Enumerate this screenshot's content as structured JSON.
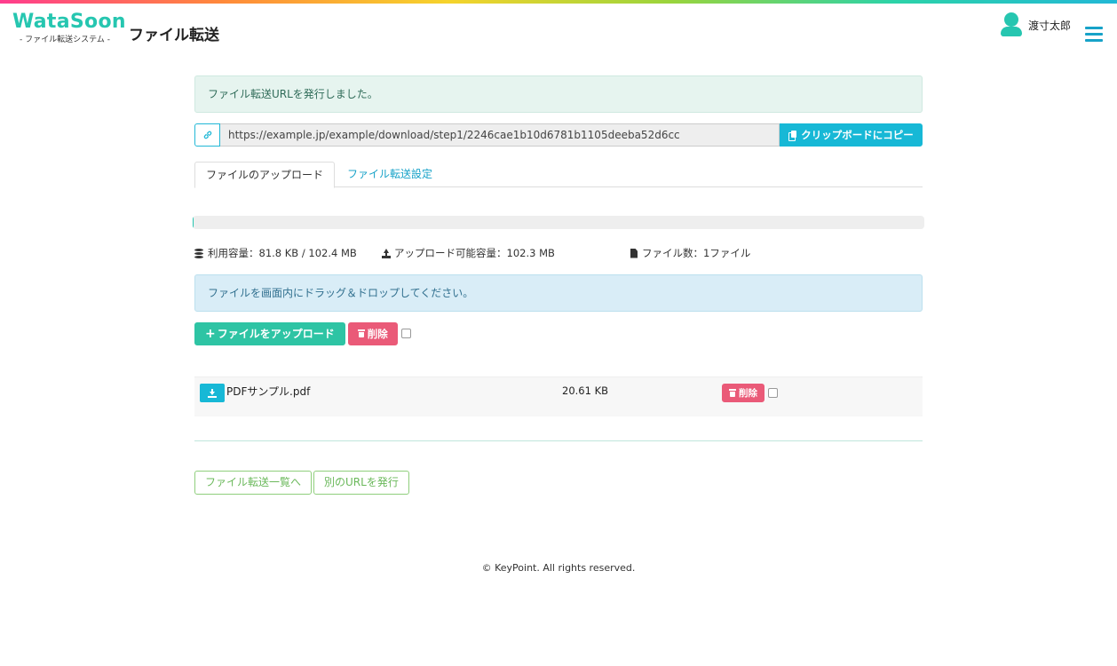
{
  "header": {
    "logo_main": "WataSoon",
    "logo_sub": "- ファイル転送システム -",
    "title": "ファイル転送",
    "user_name": "渡寸太郎"
  },
  "alert_success": "ファイル転送URLを発行しました。",
  "url": {
    "value": "https://example.jp/example/download/step1/2246cae1b10d6781b1105deeba52d6cc",
    "copy_label": "クリップボードにコピー"
  },
  "tabs": [
    {
      "label": "ファイルのアップロード",
      "active": true
    },
    {
      "label": "ファイル転送設定",
      "active": false
    }
  ],
  "progress": {
    "value_percent": 0.08
  },
  "stats": {
    "usage": "利用容量：81.8 KB / 102.4 MB",
    "uploadable": "アップロード可能容量：102.3 MB",
    "file_count": "ファイル数：1ファイル"
  },
  "alert_info": "ファイルを画面内にドラッグ＆ドロップしてください。",
  "actions": {
    "upload_label": "ファイルをアップロード",
    "delete_label": "削除"
  },
  "files": [
    {
      "name": "PDFサンプル.pdf",
      "size": "20.61 KB",
      "delete_label": "削除"
    }
  ],
  "bottom": {
    "list_label": "ファイル転送一覧へ",
    "new_url_label": "別のURLを発行"
  },
  "footer": "© KeyPoint. All rights reserved.",
  "colors": {
    "brand": "#26c6b0",
    "info": "#17b8d6",
    "danger": "#ea5a78",
    "outline": "#8fce7c"
  },
  "icons": {
    "link": "link-icon",
    "copy": "copy-icon",
    "usage": "database-icon",
    "upload": "upload-icon",
    "file": "file-icon",
    "download": "download-icon",
    "trash": "trash-icon",
    "user": "user-icon",
    "menu": "hamburger-menu-icon"
  }
}
